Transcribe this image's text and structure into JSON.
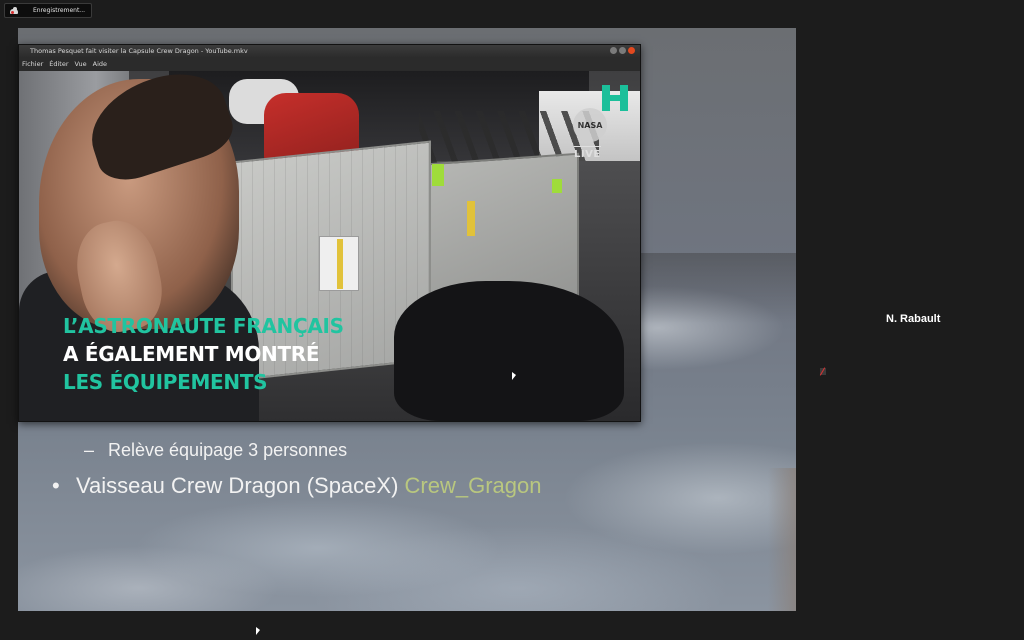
{
  "recording": {
    "label": "Enregistrement..."
  },
  "video_window": {
    "title": "Thomas Pesquet fait visiter la Capsule Crew Dragon - YouTube.mkv",
    "menu": [
      "Fichier",
      "Éditer",
      "Vue",
      "Aide"
    ]
  },
  "video": {
    "caption_lines": [
      "L’ASTRONAUTE FRANÇAIS",
      "A ÉGALEMENT MONTRÉ",
      "LES ÉQUIPEMENTS"
    ],
    "nasa_text": "NASA",
    "live_badge": "LIVE"
  },
  "slide": {
    "sub_bullet": "Relève équipage 3 personnes",
    "bullet_text": "Vaisseau Crew Dragon (SpaceX)",
    "bullet_link": "Crew_Gragon"
  },
  "participant": {
    "name": "N. Rabault"
  },
  "colors": {
    "caption_teal": "#21c4a0",
    "caption_white": "#ffffff",
    "link_green": "#b9c77f",
    "close_button": "#e2491f"
  }
}
